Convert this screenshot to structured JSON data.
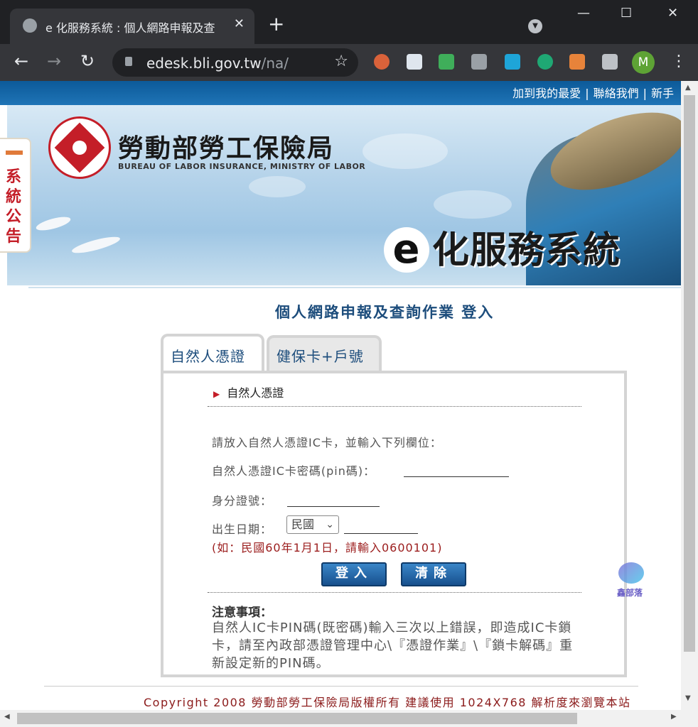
{
  "browser": {
    "tab_title": "e 化服務系統 : 個人網路申報及查",
    "new_tab": "+",
    "url_host": "edesk.bli.gov.tw",
    "url_path": "/na/",
    "profile_initial": "M"
  },
  "site": {
    "top_links": [
      "加到我的最愛",
      "聯絡我們",
      "新手"
    ],
    "org_name_cn": "勞動部勞工保險局",
    "org_name_en": "BUREAU OF LABOR INSURANCE, MINISTRY OF LABOR",
    "service_e": "e",
    "service_name": "化服務系統",
    "side_notice": "系統公告"
  },
  "login": {
    "title": "個人網路申報及查詢作業 登入",
    "tabs": [
      "自然人憑證",
      "健保卡+戶號"
    ],
    "section_head": "自然人憑證",
    "instruction": "請放入自然人憑證IC卡，並輸入下列欄位：",
    "pin_label": "自然人憑證IC卡密碼(pin碼)：",
    "id_label": "身分證號：",
    "birth_label": "出生日期：",
    "era_value": "民國",
    "hint": "(如：民國60年1月1日，請輸入0600101)",
    "login_button": "登入",
    "clear_button": "清除",
    "notice_title": "注意事項：",
    "notice_body": "自然人IC卡PIN碼(既密碼)輸入三次以上錯誤，即造成IC卡鎖卡，請至內政部憑證管理中心\\『憑證作業』\\『鎖卡解碼』重新設定新的PIN碼。"
  },
  "watermark": "鑫部落",
  "footer": "Copyright 2008 勞動部勞工保險局版權所有 建議使用 1024X768 解析度來瀏覽本站"
}
